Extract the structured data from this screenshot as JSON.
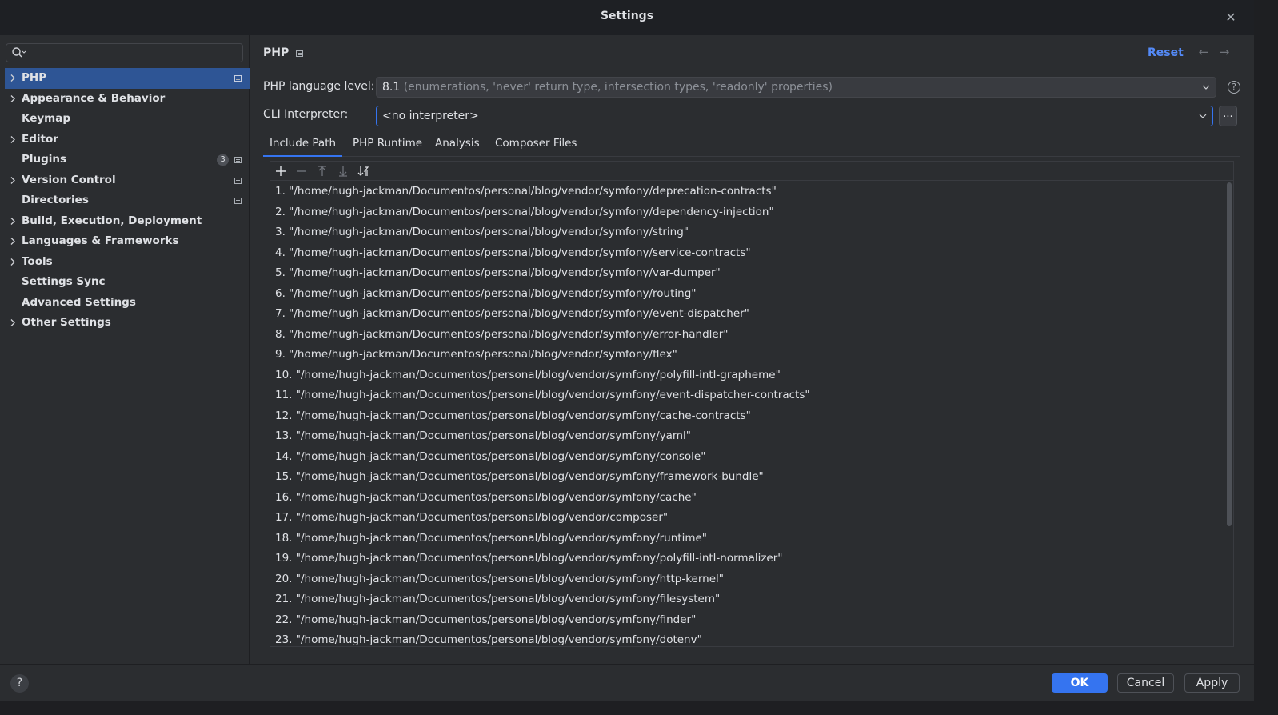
{
  "window": {
    "title": "Settings",
    "close_icon": "close-icon"
  },
  "colors": {
    "accent": "#3574f0",
    "link": "#548af7",
    "selection": "#2e5595",
    "background": "#2b2d30"
  },
  "sidebar": {
    "search": {
      "value": "",
      "placeholder": ""
    },
    "items": [
      {
        "label": "PHP",
        "expandable": true,
        "selected": true,
        "flag": true
      },
      {
        "label": "Appearance & Behavior",
        "expandable": true
      },
      {
        "label": "Keymap",
        "expandable": false
      },
      {
        "label": "Editor",
        "expandable": true
      },
      {
        "label": "Plugins",
        "expandable": false,
        "badge": "3",
        "flag": true
      },
      {
        "label": "Version Control",
        "expandable": true,
        "flag": true
      },
      {
        "label": "Directories",
        "expandable": false,
        "flag": true
      },
      {
        "label": "Build, Execution, Deployment",
        "expandable": true
      },
      {
        "label": "Languages & Frameworks",
        "expandable": true
      },
      {
        "label": "Tools",
        "expandable": true
      },
      {
        "label": "Settings Sync",
        "expandable": false
      },
      {
        "label": "Advanced Settings",
        "expandable": false
      },
      {
        "label": "Other Settings",
        "expandable": true
      }
    ]
  },
  "main": {
    "breadcrumb": "PHP",
    "reset_label": "Reset",
    "language_level": {
      "label": "PHP language level:",
      "version": "8.1",
      "description": "(enumerations, 'never' return type, intersection types, 'readonly' properties)"
    },
    "cli_interpreter": {
      "label": "CLI Interpreter:",
      "value": "<no interpreter>",
      "browse_label": "..."
    },
    "tabs": [
      {
        "label": "Include Path",
        "active": true
      },
      {
        "label": "PHP Runtime",
        "active": false
      },
      {
        "label": "Analysis",
        "active": false
      },
      {
        "label": "Composer Files",
        "active": false
      }
    ],
    "include_paths": [
      "1. \"/home/hugh-jackman/Documentos/personal/blog/vendor/symfony/deprecation-contracts\"",
      "2. \"/home/hugh-jackman/Documentos/personal/blog/vendor/symfony/dependency-injection\"",
      "3. \"/home/hugh-jackman/Documentos/personal/blog/vendor/symfony/string\"",
      "4. \"/home/hugh-jackman/Documentos/personal/blog/vendor/symfony/service-contracts\"",
      "5. \"/home/hugh-jackman/Documentos/personal/blog/vendor/symfony/var-dumper\"",
      "6. \"/home/hugh-jackman/Documentos/personal/blog/vendor/symfony/routing\"",
      "7. \"/home/hugh-jackman/Documentos/personal/blog/vendor/symfony/event-dispatcher\"",
      "8. \"/home/hugh-jackman/Documentos/personal/blog/vendor/symfony/error-handler\"",
      "9. \"/home/hugh-jackman/Documentos/personal/blog/vendor/symfony/flex\"",
      "10. \"/home/hugh-jackman/Documentos/personal/blog/vendor/symfony/polyfill-intl-grapheme\"",
      "11. \"/home/hugh-jackman/Documentos/personal/blog/vendor/symfony/event-dispatcher-contracts\"",
      "12. \"/home/hugh-jackman/Documentos/personal/blog/vendor/symfony/cache-contracts\"",
      "13. \"/home/hugh-jackman/Documentos/personal/blog/vendor/symfony/yaml\"",
      "14. \"/home/hugh-jackman/Documentos/personal/blog/vendor/symfony/console\"",
      "15. \"/home/hugh-jackman/Documentos/personal/blog/vendor/symfony/framework-bundle\"",
      "16. \"/home/hugh-jackman/Documentos/personal/blog/vendor/symfony/cache\"",
      "17. \"/home/hugh-jackman/Documentos/personal/blog/vendor/composer\"",
      "18. \"/home/hugh-jackman/Documentos/personal/blog/vendor/symfony/runtime\"",
      "19. \"/home/hugh-jackman/Documentos/personal/blog/vendor/symfony/polyfill-intl-normalizer\"",
      "20. \"/home/hugh-jackman/Documentos/personal/blog/vendor/symfony/http-kernel\"",
      "21. \"/home/hugh-jackman/Documentos/personal/blog/vendor/symfony/filesystem\"",
      "22. \"/home/hugh-jackman/Documentos/personal/blog/vendor/symfony/finder\"",
      "23. \"/home/hugh-jackman/Documentos/personal/blog/vendor/symfony/dotenv\""
    ]
  },
  "footer": {
    "help_label": "?",
    "ok_label": "OK",
    "cancel_label": "Cancel",
    "apply_label": "Apply"
  }
}
